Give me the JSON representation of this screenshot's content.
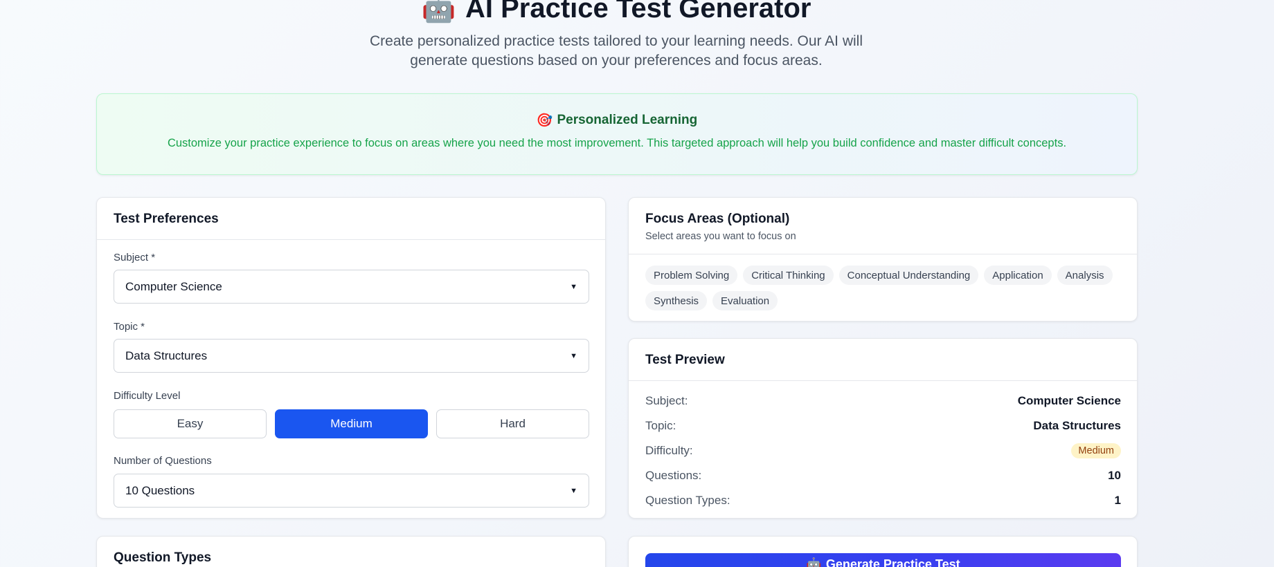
{
  "header": {
    "icon": "robot-emoji",
    "icon_glyph": "🤖",
    "title": "AI Practice Test Generator",
    "subtitle": "Create personalized practice tests tailored to your learning needs. Our AI will generate questions based on your preferences and focus areas."
  },
  "banner": {
    "icon": "target-emoji",
    "icon_glyph": "🎯",
    "title": "Personalized Learning",
    "text": "Customize your practice experience to focus on areas where you need the most improvement. This targeted approach will help you build confidence and master difficult concepts."
  },
  "preferences": {
    "title": "Test Preferences",
    "subject_label": "Subject *",
    "subject_value": "Computer Science",
    "topic_label": "Topic *",
    "topic_value": "Data Structures",
    "difficulty_label": "Difficulty Level",
    "difficulty_options": [
      "Easy",
      "Medium",
      "Hard"
    ],
    "difficulty_selected": "Medium",
    "questions_label": "Number of Questions",
    "questions_value": "10 Questions"
  },
  "focus": {
    "title": "Focus Areas (Optional)",
    "subtitle": "Select areas you want to focus on",
    "chips": [
      "Problem Solving",
      "Critical Thinking",
      "Conceptual Understanding",
      "Application",
      "Analysis",
      "Synthesis",
      "Evaluation"
    ]
  },
  "preview": {
    "title": "Test Preview",
    "rows": [
      {
        "key": "Subject:",
        "value": "Computer Science"
      },
      {
        "key": "Topic:",
        "value": "Data Structures"
      },
      {
        "key": "Difficulty:",
        "value": "Medium"
      },
      {
        "key": "Questions:",
        "value": "10"
      },
      {
        "key": "Question Types:",
        "value": "1"
      }
    ]
  },
  "question_types": {
    "title": "Question Types"
  },
  "generate": {
    "icon_glyph": "🤖",
    "label": "Generate Practice Test"
  },
  "colors": {
    "primary": "#1a56f0",
    "banner_title": "#166534",
    "banner_text": "#16a34a",
    "badge_bg": "#fef3c7",
    "badge_text": "#92400e"
  }
}
